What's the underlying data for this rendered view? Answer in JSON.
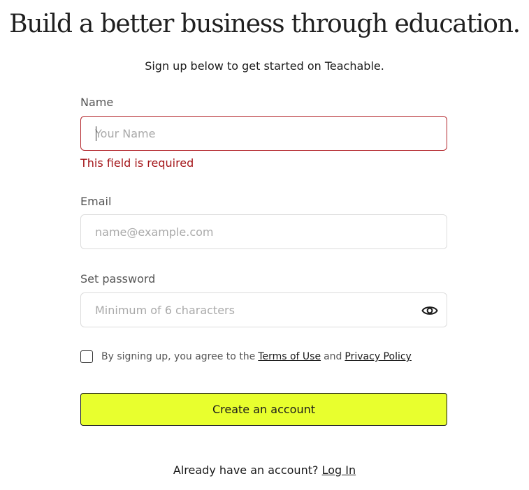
{
  "headline": "Build a better business through education.",
  "subheadline": "Sign up below to get started on Teachable.",
  "form": {
    "name": {
      "label": "Name",
      "placeholder": "Your Name",
      "value": "",
      "error": "This field is required"
    },
    "email": {
      "label": "Email",
      "placeholder": "name@example.com",
      "value": ""
    },
    "password": {
      "label": "Set password",
      "placeholder": "Minimum of 6 characters",
      "value": "",
      "toggle_icon": "eye-icon"
    },
    "consent": {
      "checked": false,
      "prefix": "By signing up, you agree to the",
      "terms_link": "Terms of Use",
      "conjunction": "and",
      "privacy_link": "Privacy Policy"
    },
    "submit_label": "Create an account"
  },
  "footer": {
    "prompt": "Already have an account?",
    "login_link": "Log In"
  },
  "colors": {
    "accent_button": "#e8ff2e",
    "error": "#a4161a",
    "error_border": "#b3262c"
  }
}
